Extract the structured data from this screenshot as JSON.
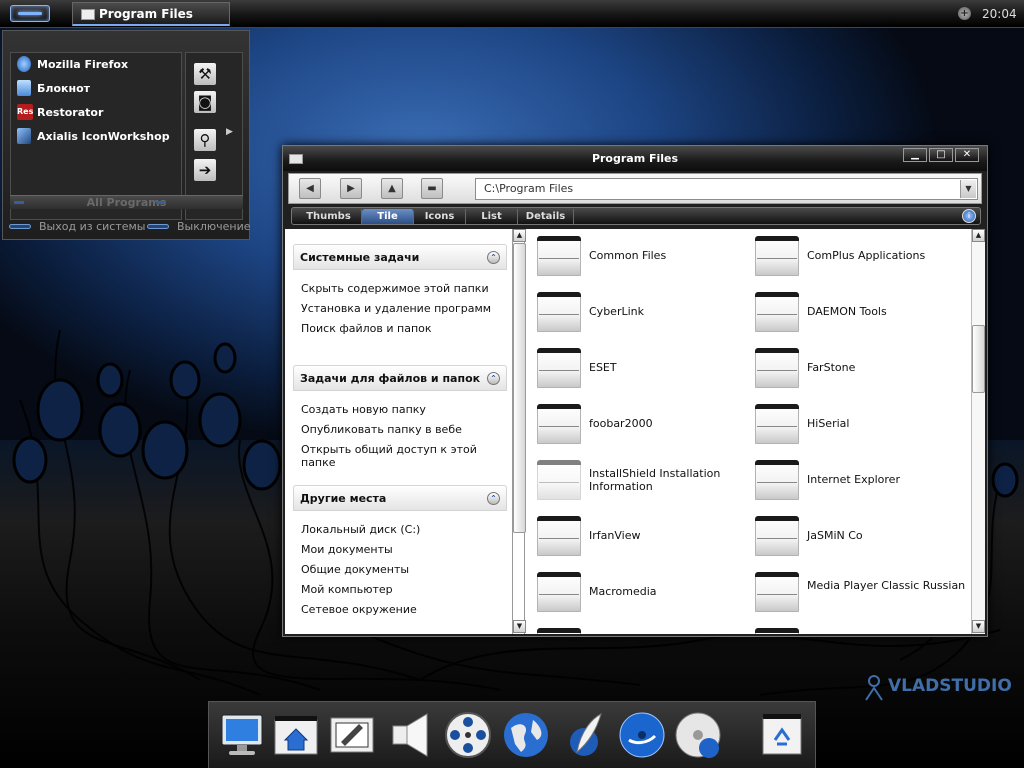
{
  "taskbar": {
    "task_title": "Program Files",
    "clock": "20:04",
    "tray_symbol": "+",
    "icons": [
      "start-button",
      "folder-icon",
      "tray-network-icon"
    ]
  },
  "start_menu": {
    "items": [
      {
        "label": "Mozilla Firefox",
        "icon": "firefox-icon"
      },
      {
        "label": "Блокнот",
        "icon": "notepad-icon"
      },
      {
        "label": "Restorator",
        "icon": "restorator-icon",
        "badge": "Res"
      },
      {
        "label": "Axialis IconWorkshop",
        "icon": "iconworkshop-icon"
      }
    ],
    "tools": [
      "tools-icon",
      "control-panel-icon",
      "search-icon",
      "run-icon"
    ],
    "tool_glyphs": [
      "⚒",
      "◙",
      "⚲",
      "➔"
    ],
    "all_programs": "All Programs",
    "logoff": "Выход из системы",
    "shutdown": "Выключение",
    "submenu_arrow": "▶"
  },
  "window": {
    "title": "Program Files",
    "controls": {
      "minimize": "▁",
      "maximize": "□",
      "close": "✕"
    },
    "toolbar": {
      "back": "◀",
      "forward": "▶",
      "up": "▲",
      "folders": "▬",
      "address": "C:\\Program Files",
      "dropdown": "▼"
    },
    "views": [
      {
        "label": "Thumbs",
        "active": false
      },
      {
        "label": "Tile",
        "active": true
      },
      {
        "label": "Icons",
        "active": false
      },
      {
        "label": "List",
        "active": false
      },
      {
        "label": "Details",
        "active": false
      }
    ],
    "view_info": "i"
  },
  "task_pane": {
    "sections": [
      {
        "title": "Системные задачи",
        "links": [
          "Скрыть содержимое этой папки",
          "Установка и удаление программ",
          "Поиск файлов и папок"
        ]
      },
      {
        "title": "Задачи для файлов и папок",
        "links": [
          "Создать новую папку",
          "Опубликовать папку в вебе",
          "Открыть общий доступ к этой папке"
        ]
      },
      {
        "title": "Другие места",
        "links": [
          "Локальный диск (C:)",
          "Мои документы",
          "Общие документы",
          "Мой компьютер",
          "Сетевое окружение"
        ]
      }
    ],
    "collapse_glyph": "⌃"
  },
  "scrollbar": {
    "up": "▲",
    "down": "▼"
  },
  "folders": [
    "Common Files",
    "ComPlus Applications",
    "CyberLink",
    "DAEMON Tools",
    "ESET",
    "FarStone",
    "foobar2000",
    "HiSerial",
    "InstallShield Installation Information",
    "Internet Explorer",
    "IrfanView",
    "JaSMiN Co",
    "Macromedia",
    "Media Player Classic Russian"
  ],
  "faded_folder": "InstallShield Installation Information",
  "dock": {
    "items": [
      "my-computer-icon",
      "home-folder-icon",
      "edit-icon",
      "speaker-icon",
      "media-reel-icon",
      "globe-icon",
      "quill-icon",
      "media-disc-icon",
      "dvd-disc-icon",
      "recycle-bin-icon"
    ]
  },
  "watermark": "VLADSTUDIO",
  "colors": {
    "accent": "#7aaaf0",
    "wallpaper": "#1d4584",
    "window_chrome": "#202020"
  }
}
